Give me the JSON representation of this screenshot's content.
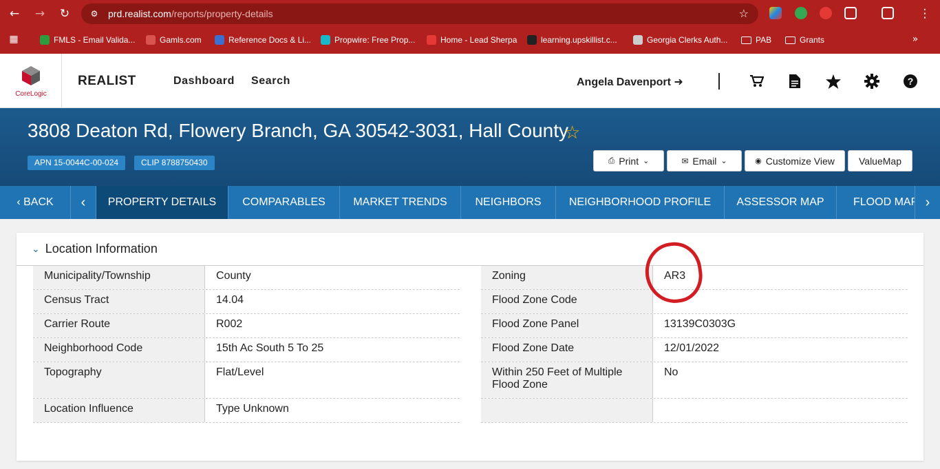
{
  "browser": {
    "url_host": "prd.realist.com",
    "url_path": "/reports/property-details",
    "bookmarks": [
      {
        "label": "FMLS - Email Valida...",
        "color": "#2e9b3f"
      },
      {
        "label": "Gamls.com",
        "color": "#d9534f"
      },
      {
        "label": "Reference Docs & Li...",
        "color": "#3d6fd1"
      },
      {
        "label": "Propwire: Free Prop...",
        "color": "#19b8c9"
      },
      {
        "label": "Home - Lead Sherpa",
        "color": "#e53935"
      },
      {
        "label": "learning.upskillist.c...",
        "color": "#222222"
      },
      {
        "label": "Georgia Clerks Auth...",
        "color": "#cccccc"
      },
      {
        "label": "PAB",
        "color": ""
      },
      {
        "label": "Grants",
        "color": ""
      }
    ]
  },
  "header": {
    "logo_text": "CoreLogic",
    "brand": "REALIST",
    "nav": [
      "Dashboard",
      "Search"
    ],
    "user_name": "Angela Davenport"
  },
  "property": {
    "address": "3808 Deaton Rd, Flowery Branch, GA 30542-3031, Hall County",
    "apn": "APN 15-0044C-00-024",
    "clip": "CLIP 8788750430",
    "actions": [
      "Print",
      "Email",
      "Customize View",
      "ValueMap"
    ]
  },
  "tabs": {
    "back_label": "BACK",
    "items": [
      "PROPERTY DETAILS",
      "COMPARABLES",
      "MARKET TRENDS",
      "NEIGHBORS",
      "NEIGHBORHOOD PROFILE",
      "ASSESSOR MAP",
      "FLOOD MAP"
    ],
    "active": "PROPERTY DETAILS"
  },
  "location": {
    "title": "Location Information",
    "left": [
      {
        "label": "Municipality/Township",
        "value": "County"
      },
      {
        "label": "Census Tract",
        "value": "14.04"
      },
      {
        "label": "Carrier Route",
        "value": "R002"
      },
      {
        "label": "Neighborhood Code",
        "value": "15th Ac South 5 To 25"
      },
      {
        "label": "Topography",
        "value": "Flat/Level"
      },
      {
        "label": "Location Influence",
        "value": "Type Unknown"
      }
    ],
    "right": [
      {
        "label": "Zoning",
        "value": "AR3"
      },
      {
        "label": "Flood Zone Code",
        "value": ""
      },
      {
        "label": "Flood Zone Panel",
        "value": "13139C0303G"
      },
      {
        "label": "Flood Zone Date",
        "value": "12/01/2022"
      },
      {
        "label": "Within 250 Feet of Multiple Flood Zone",
        "value": "No"
      },
      {
        "label": "",
        "value": ""
      }
    ]
  }
}
